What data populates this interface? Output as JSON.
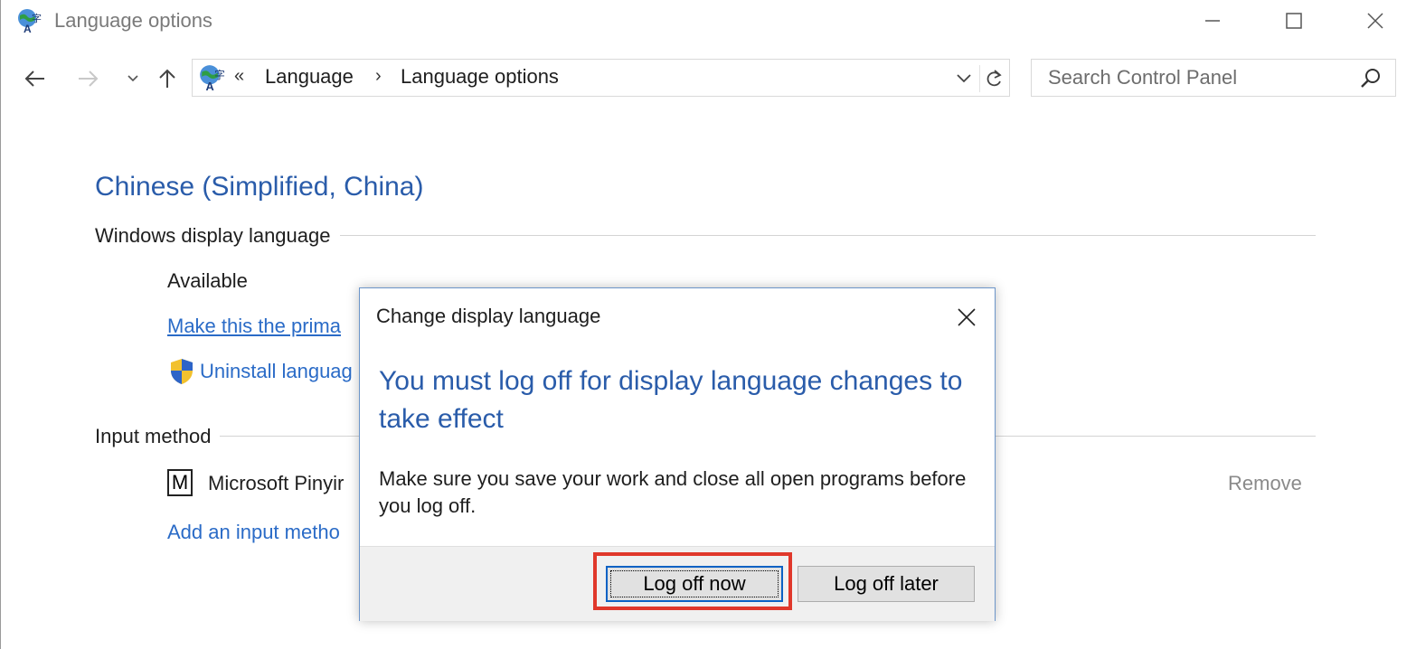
{
  "window": {
    "title": "Language options",
    "controls": {
      "minimize": "—",
      "maximize": "☐",
      "close": "✕"
    }
  },
  "nav": {
    "back": "←",
    "forward": "→",
    "recent": "˅",
    "up": "↑",
    "address": {
      "overflow": "«",
      "crumbs": [
        "Language",
        "Language options"
      ],
      "separator": "›"
    },
    "search": {
      "placeholder": "Search Control Panel"
    }
  },
  "content": {
    "language_name": "Chinese (Simplified, China)",
    "display_language": {
      "heading": "Windows display language",
      "status": "Available",
      "make_primary_link": "Make this the prima",
      "uninstall_link": "Uninstall languag"
    },
    "input_method": {
      "heading": "Input method",
      "ime_badge": "M",
      "ime_name": "Microsoft Pinyir",
      "remove_link": "Remove",
      "add_link": "Add an input metho"
    }
  },
  "dialog": {
    "title": "Change display language",
    "heading": "You must log off for display language changes to take effect",
    "body": "Make sure you save your work and close all open programs before you log off.",
    "buttons": {
      "log_off_now": "Log off now",
      "log_off_later": "Log off later"
    }
  },
  "colors": {
    "accent_blue": "#2a5caa",
    "link_blue": "#2a6bc7",
    "highlight_red": "#e0382b",
    "dialog_border": "#6c95c9"
  },
  "icons": [
    "language-globe-icon",
    "back-arrow-icon",
    "forward-arrow-icon",
    "chevron-down-icon",
    "up-arrow-icon",
    "refresh-icon",
    "search-icon",
    "uac-shield-icon",
    "close-icon"
  ]
}
